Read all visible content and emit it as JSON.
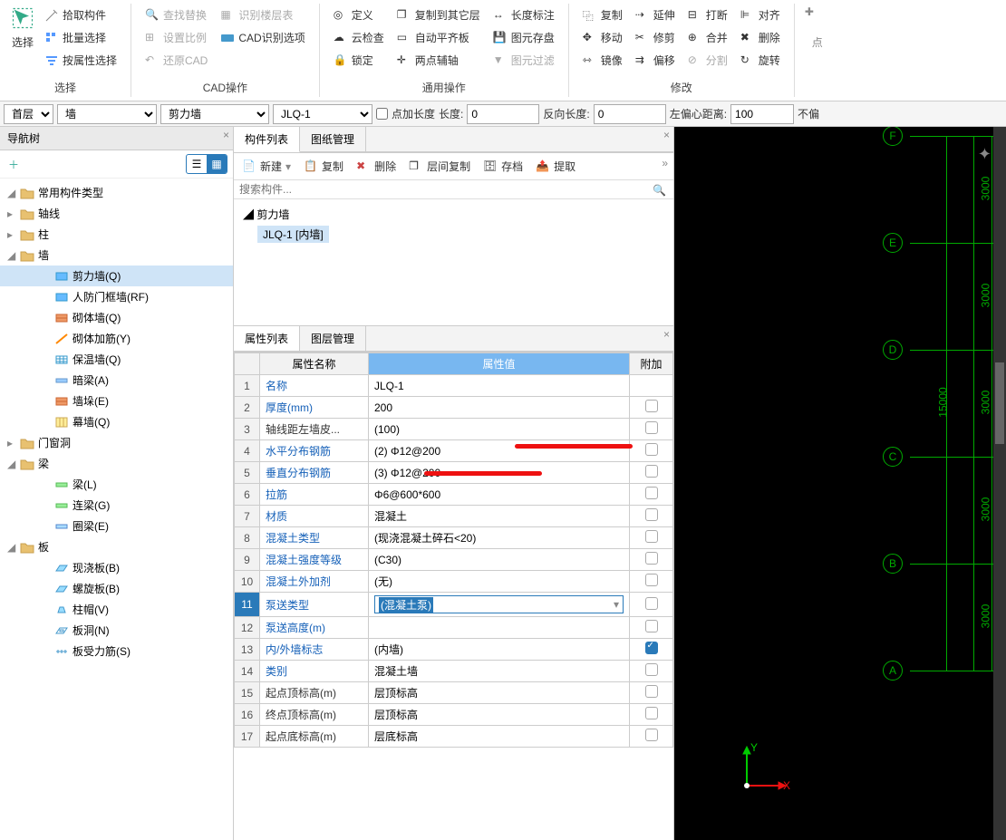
{
  "ribbon": {
    "select_group": {
      "big": "选择",
      "items": [
        "拾取构件",
        "批量选择",
        "按属性选择"
      ],
      "label": "选择"
    },
    "cad_group": {
      "items_col1": [
        "查找替换",
        "设置比例",
        "还原CAD"
      ],
      "items_col2": [
        "识别楼层表",
        "CAD识别选项"
      ],
      "label": "CAD操作"
    },
    "common_group": {
      "col1": [
        "定义",
        "云检查",
        "锁定"
      ],
      "col2": [
        "复制到其它层",
        "自动平齐板",
        "两点辅轴"
      ],
      "col3": [
        "长度标注",
        "图元存盘",
        "图元过滤"
      ],
      "label": "通用操作"
    },
    "modify_group": {
      "col1": [
        "复制",
        "移动",
        "镜像"
      ],
      "col2": [
        "延伸",
        "修剪",
        "偏移"
      ],
      "col3": [
        "打断",
        "合并",
        "分割"
      ],
      "col4": [
        "对齐",
        "删除",
        "旋转"
      ],
      "label": "修改"
    },
    "point_group": {
      "big": "点"
    }
  },
  "optbar": {
    "floor": "首层",
    "cat": "墙",
    "type": "剪力墙",
    "name": "JLQ-1",
    "chk_label": "点加长度",
    "len_label": "长度:",
    "len_val": "0",
    "rev_label": "反向长度:",
    "rev_val": "0",
    "off_label": "左偏心距离:",
    "off_val": "100",
    "trail": "不偏"
  },
  "nav": {
    "title": "导航树",
    "items": [
      {
        "t": "常用构件类型",
        "exp": "-",
        "i": 0,
        "ico": "folder"
      },
      {
        "t": "轴线",
        "exp": "+",
        "i": 0,
        "ico": "folder"
      },
      {
        "t": "柱",
        "exp": "+",
        "i": 0,
        "ico": "folder"
      },
      {
        "t": "墙",
        "exp": "-",
        "i": 0,
        "ico": "folder"
      },
      {
        "t": "剪力墙(Q)",
        "i": 2,
        "sel": true,
        "ico": "wall-blue"
      },
      {
        "t": "人防门框墙(RF)",
        "i": 2,
        "ico": "wall-blue"
      },
      {
        "t": "砌体墙(Q)",
        "i": 2,
        "ico": "wall-brick"
      },
      {
        "t": "砌体加筋(Y)",
        "i": 2,
        "ico": "rebar-orange"
      },
      {
        "t": "保温墙(Q)",
        "i": 2,
        "ico": "wall-blue-hash"
      },
      {
        "t": "暗梁(A)",
        "i": 2,
        "ico": "beam"
      },
      {
        "t": "墙垛(E)",
        "i": 2,
        "ico": "wall-brick"
      },
      {
        "t": "幕墙(Q)",
        "i": 2,
        "ico": "curtain"
      },
      {
        "t": "门窗洞",
        "exp": "+",
        "i": 0,
        "ico": "folder"
      },
      {
        "t": "梁",
        "exp": "-",
        "i": 0,
        "ico": "folder"
      },
      {
        "t": "梁(L)",
        "i": 2,
        "ico": "beam-green"
      },
      {
        "t": "连梁(G)",
        "i": 2,
        "ico": "beam-green"
      },
      {
        "t": "圈梁(E)",
        "i": 2,
        "ico": "beam-blue"
      },
      {
        "t": "板",
        "exp": "-",
        "i": 0,
        "ico": "folder"
      },
      {
        "t": "现浇板(B)",
        "i": 2,
        "ico": "slab"
      },
      {
        "t": "螺旋板(B)",
        "i": 2,
        "ico": "slab"
      },
      {
        "t": "柱帽(V)",
        "i": 2,
        "ico": "cap"
      },
      {
        "t": "板洞(N)",
        "i": 2,
        "ico": "hole"
      },
      {
        "t": "板受力筋(S)",
        "i": 2,
        "ico": "rebar-blue"
      }
    ]
  },
  "mid": {
    "tabs": [
      "构件列表",
      "图纸管理"
    ],
    "toolbar": [
      "新建",
      "复制",
      "删除",
      "层间复制",
      "存档",
      "提取"
    ],
    "search_ph": "搜索构件...",
    "tree_root": "剪力墙",
    "tree_item": "JLQ-1 [内墙]"
  },
  "proptabs": [
    "属性列表",
    "图层管理"
  ],
  "prop_headers": {
    "name": "属性名称",
    "value": "属性值",
    "extra": "附加"
  },
  "prop_rows": [
    {
      "n": "名称",
      "v": "JLQ-1",
      "link": true
    },
    {
      "n": "厚度(mm)",
      "v": "200",
      "link": true,
      "chk": false
    },
    {
      "n": "轴线距左墙皮...",
      "v": "(100)",
      "chk": false
    },
    {
      "n": "水平分布钢筋",
      "v": "(2) Φ12@200",
      "link": true,
      "chk": false,
      "mark": 1
    },
    {
      "n": "垂直分布钢筋",
      "v": "(3) Φ12@200",
      "link": true,
      "chk": false,
      "mark": 2
    },
    {
      "n": "拉筋",
      "v": "Φ6@600*600",
      "link": true,
      "chk": false
    },
    {
      "n": "材质",
      "v": "混凝土",
      "link": true,
      "chk": false
    },
    {
      "n": "混凝土类型",
      "v": "(现浇混凝土碎石<20)",
      "link": true,
      "chk": false
    },
    {
      "n": "混凝土强度等级",
      "v": "(C30)",
      "link": true,
      "chk": false
    },
    {
      "n": "混凝土外加剂",
      "v": "(无)",
      "link": true,
      "chk": false
    },
    {
      "n": "泵送类型",
      "v": "(混凝土泵)",
      "link": true,
      "chk": false,
      "sel": true,
      "dd": true
    },
    {
      "n": "泵送高度(m)",
      "v": "",
      "link": true,
      "chk": false
    },
    {
      "n": "内/外墙标志",
      "v": "(内墙)",
      "link": true,
      "chk": true
    },
    {
      "n": "类别",
      "v": "混凝土墙",
      "link": true,
      "chk": false
    },
    {
      "n": "起点顶标高(m)",
      "v": "层顶标高",
      "chk": false
    },
    {
      "n": "终点顶标高(m)",
      "v": "层顶标高",
      "chk": false
    },
    {
      "n": "起点底标高(m)",
      "v": "层底标高",
      "chk": false
    }
  ],
  "viewport": {
    "axes": [
      "F",
      "E",
      "D",
      "C",
      "B",
      "A"
    ],
    "dims": [
      "3000",
      "3000",
      "3000",
      "3000",
      "3000"
    ],
    "big_dim": "15000",
    "ucs": {
      "x": "X",
      "y": "Y"
    }
  }
}
